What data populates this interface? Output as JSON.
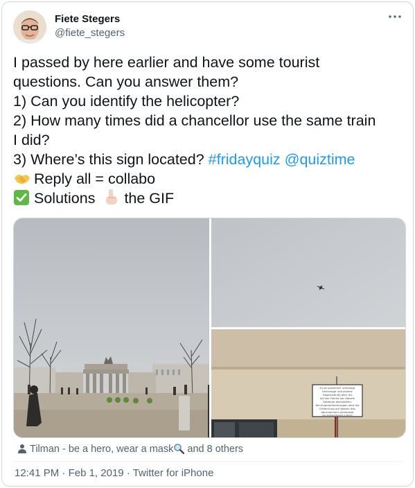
{
  "author": {
    "name": "Fiete Stegers",
    "handle": "@fiete_stegers"
  },
  "more_icon": "more-horizontal-icon",
  "tweet": {
    "line1": "I passed by here earlier and have some tourist",
    "line2": "questions. Can you answer them?",
    "line3": "1) Can you identify the helicopter?",
    "line4": "2) How many times did a chancellor use the same train",
    "line5": "I did?",
    "line6_prefix": "3) Where’s this sign located?",
    "hashtag": "#fridayquiz",
    "mention": "@quiztime",
    "line7": "Reply all = collabo",
    "line8_a": "Solutions",
    "line8_b": "the GIF",
    "emojis": [
      "handshake-emoji",
      "check-mark-emoji",
      "pointing-down-emoji"
    ]
  },
  "media": {
    "images": [
      "brandenburg-gate-photo",
      "helicopter-in-sky-photo",
      "wall-sign-photo"
    ],
    "sign_text": [
      "Es ist polizeilich untersagt",
      "Fahrzeuge und andere",
      "Gegenstände aller Art",
      "auf der Fläche vor diesem",
      "Gebäude abzustellen.",
      "Bei Zuwiderhandlungen wird die",
      "Entfernung auf Kosten des",
      "Verursachers veranlasst",
      "Der Polizeipräsident in Berlin"
    ]
  },
  "tagged": {
    "text_before": "Tilman - be a hero, wear a mask",
    "text_after": " and 8 others"
  },
  "meta": {
    "time": "12:41 PM",
    "separator": " · ",
    "date": "Feb 1, 2019",
    "source": "Twitter for iPhone"
  },
  "colors": {
    "link": "#1d9bf0",
    "secondary_text": "#536471",
    "primary_text": "#0f1419",
    "border": "#cfd9de"
  }
}
